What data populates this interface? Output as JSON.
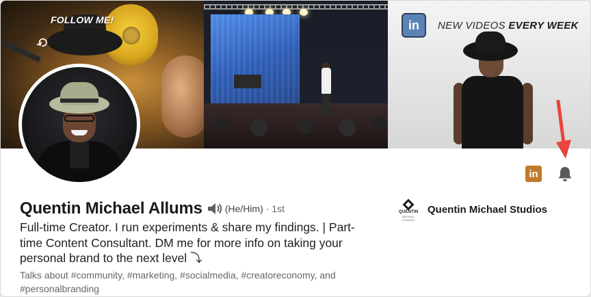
{
  "banner": {
    "follow_text": "FOLLOW ME!",
    "li_badge": "in",
    "new_videos_prefix": "NEW VIDEOS ",
    "new_videos_bold": "EVERY WEEK"
  },
  "profile": {
    "name": "Quentin Michael Allums",
    "pronouns": "(He/Him)",
    "degree": "· 1st",
    "headline": "Full-time Creator. I run experiments & share my findings. | Part-time Content Consultant. DM me for more info on taking your personal brand to the next level ⤵",
    "talks_about": "Talks about #community, #marketing, #socialmedia, #creatoreconomy, and #personalbranding"
  },
  "company": {
    "logo_text": "QUENTIN",
    "logo_subtext": "MICHAEL STUDIOS",
    "name": "Quentin Michael Studios"
  },
  "actions": {
    "linkedin_badge": "in"
  },
  "colors": {
    "accent_arrow": "#e8453c",
    "linkedin_badge": "#c07a2a",
    "bell": "#5a5a5a"
  },
  "icons": {
    "speaker": "speaker-icon",
    "bell": "bell-icon",
    "linkedin": "linkedin-icon",
    "arrow": "arrow-down-icon"
  }
}
